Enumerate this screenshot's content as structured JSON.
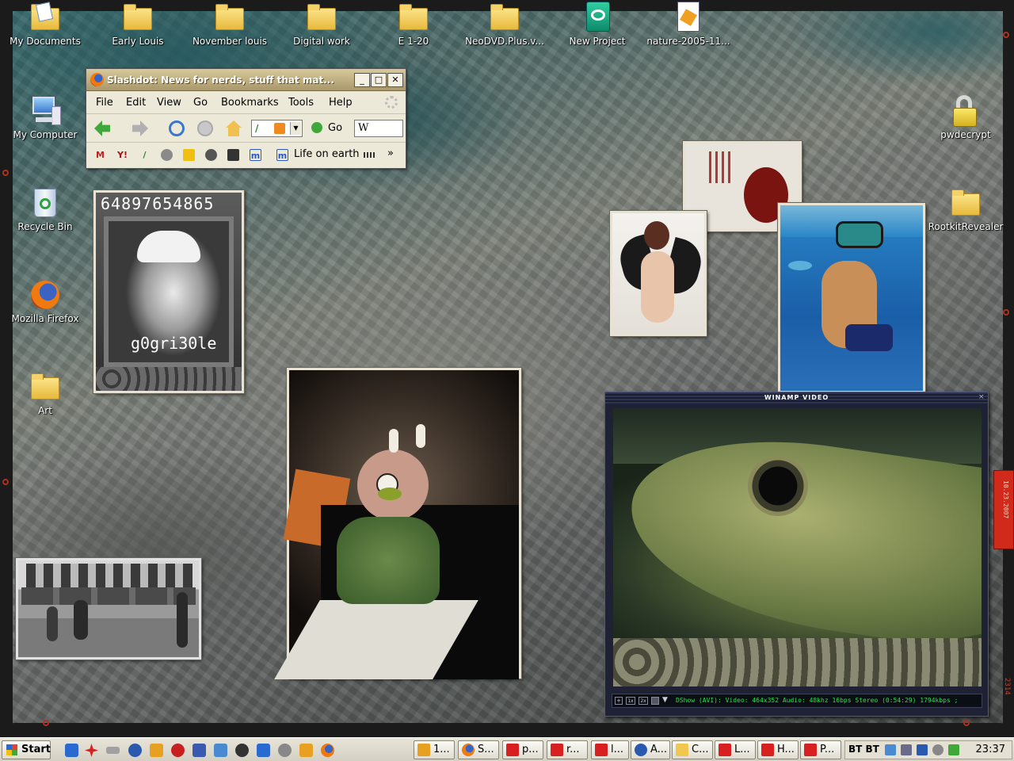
{
  "desktop": {
    "icons": [
      {
        "label": "My Documents"
      },
      {
        "label": "Early Louis"
      },
      {
        "label": "November louis"
      },
      {
        "label": "Digital work"
      },
      {
        "label": "E 1-20"
      },
      {
        "label": "NeoDVD.Plus.v..."
      },
      {
        "label": "New Project"
      },
      {
        "label": "nature-2005-11..."
      },
      {
        "label": "My Computer"
      },
      {
        "label": "Recycle Bin"
      },
      {
        "label": "Mozilla Firefox"
      },
      {
        "label": "Art"
      },
      {
        "label": "pwdecrypt"
      },
      {
        "label": "RootkitRevealer"
      }
    ]
  },
  "photos": {
    "mugshot_caption_top": "64897654865",
    "mugshot_caption_bottom": "g0gri30le"
  },
  "firefox": {
    "title": "Slashdot: News for nerds, stuff that mat...",
    "menu": [
      "File",
      "Edit",
      "View",
      "Go",
      "Bookmarks",
      "Tools",
      "Help"
    ],
    "go_label": "Go",
    "search_value": "W",
    "bookmark_life": "Life on earth",
    "bookmark_chevron": "»",
    "window_buttons": {
      "minimize": "_",
      "maximize": "□",
      "close": "✕"
    }
  },
  "winamp": {
    "title": "WINAMP VIDEO",
    "status": "DShow (AVI): Video: 464x352 Audio: 48khz 16bps Stereo (0:54:29) 1794kbps ;",
    "controls": [
      "1x",
      "2x"
    ]
  },
  "frame": {
    "side_tab_text": "10.23.2007",
    "corner_number": "2314"
  },
  "taskbar": {
    "start_label": "Start",
    "tasks": [
      {
        "label": "1..."
      },
      {
        "label": "S..."
      },
      {
        "label": "p..."
      },
      {
        "label": "r..."
      },
      {
        "label": "l..."
      },
      {
        "label": "A..."
      },
      {
        "label": "C..."
      },
      {
        "label": "L..."
      },
      {
        "label": "H..."
      },
      {
        "label": "P..."
      }
    ],
    "tray_text": "BT BT",
    "clock": "23:37"
  }
}
